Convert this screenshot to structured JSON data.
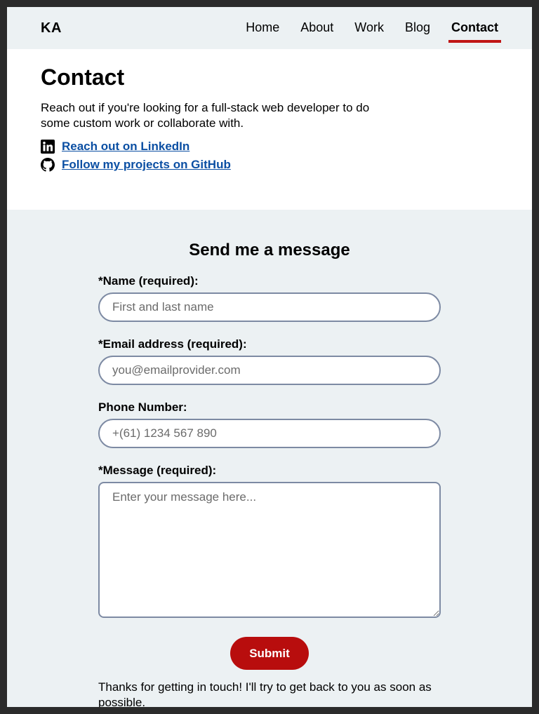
{
  "header": {
    "logo": "KA",
    "nav": [
      {
        "label": "Home"
      },
      {
        "label": "About"
      },
      {
        "label": "Work"
      },
      {
        "label": "Blog"
      },
      {
        "label": "Contact",
        "active": true
      }
    ]
  },
  "hero": {
    "title": "Contact",
    "description": "Reach out if you're looking for a full-stack web developer to do some custom work or collaborate with.",
    "links": [
      {
        "label": "Reach out on LinkedIn",
        "icon": "linkedin-icon"
      },
      {
        "label": "Follow my projects on GitHub",
        "icon": "github-icon"
      }
    ]
  },
  "form": {
    "title": "Send me a message",
    "name": {
      "label": "*Name (required):",
      "placeholder": "First and last name"
    },
    "email": {
      "label": "*Email address (required):",
      "placeholder": "you@emailprovider.com"
    },
    "phone": {
      "label": "Phone Number:",
      "placeholder": "+(61) 1234 567 890"
    },
    "message": {
      "label": "*Message (required):",
      "placeholder": "Enter your message here..."
    },
    "submit_label": "Submit",
    "thanks": "Thanks for getting in touch! I'll try to get back to you as soon as possible."
  },
  "colors": {
    "accent": "#c01616",
    "link": "#0b4fa3",
    "section_bg": "#ecf1f3"
  }
}
